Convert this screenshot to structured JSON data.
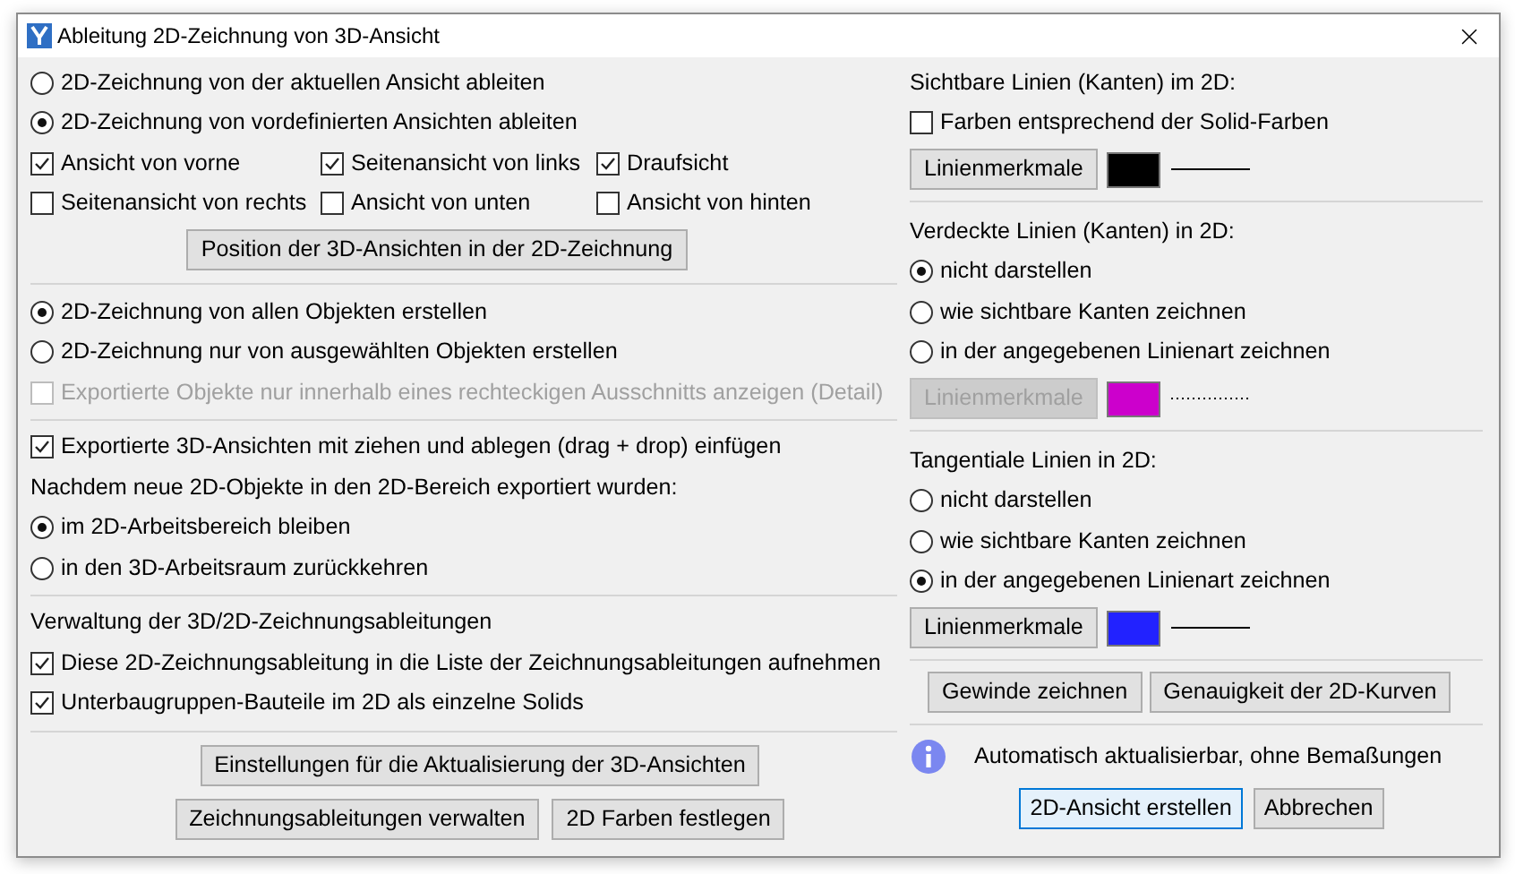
{
  "window": {
    "title": "Ableitung 2D-Zeichnung von 3D-Ansicht"
  },
  "left": {
    "source_options": [
      {
        "label": "2D-Zeichnung von der aktuellen Ansicht ableiten",
        "selected": false
      },
      {
        "label": "2D-Zeichnung von vordefinierten Ansichten ableiten",
        "selected": true
      }
    ],
    "views": [
      {
        "label": "Ansicht von vorne",
        "checked": true
      },
      {
        "label": "Seitenansicht von links",
        "checked": true
      },
      {
        "label": "Draufsicht",
        "checked": true
      },
      {
        "label": "Seitenansicht von rechts",
        "checked": false
      },
      {
        "label": "Ansicht von unten",
        "checked": false
      },
      {
        "label": "Ansicht von hinten",
        "checked": false
      }
    ],
    "position_button": "Position der 3D-Ansichten in der 2D-Zeichnung",
    "object_options": [
      {
        "label": "2D-Zeichnung von allen Objekten erstellen",
        "selected": true
      },
      {
        "label": "2D-Zeichnung nur von ausgewählten Objekten erstellen",
        "selected": false
      }
    ],
    "detail_option": {
      "label": "Exportierte Objekte nur innerhalb eines rechteckigen Ausschnitts anzeigen (Detail)",
      "checked": false,
      "disabled": true
    },
    "drag_drop": {
      "label": "Exportierte 3D-Ansichten mit ziehen und ablegen (drag + drop) einfügen",
      "checked": true
    },
    "after_export_label": "Nachdem neue 2D-Objekte in den 2D-Bereich exportiert wurden:",
    "after_export_options": [
      {
        "label": "im 2D-Arbeitsbereich bleiben",
        "selected": true
      },
      {
        "label": "in den 3D-Arbeitsraum zurückkehren",
        "selected": false
      }
    ],
    "management_label": "Verwaltung der 3D/2D-Zeichnungsableitungen",
    "management_options": [
      {
        "label": "Diese 2D-Zeichnungsableitung in die Liste der Zeichnungsableitungen aufnehmen",
        "checked": true
      },
      {
        "label": "Unterbaugruppen-Bauteile im 2D als einzelne Solids",
        "checked": true
      }
    ],
    "update_button": "Einstellungen für die Aktualisierung der 3D-Ansichten",
    "bottom_buttons": [
      "Zeichnungsableitungen verwalten",
      "2D Farben festlegen"
    ]
  },
  "right": {
    "sections": [
      {
        "title": "Sichtbare Linien (Kanten) im 2D:",
        "checkbox": {
          "label": "Farben entsprechend der Solid-Farben",
          "checked": false
        },
        "line_button": {
          "label": "Linienmerkmale",
          "disabled": false
        },
        "color": "#000000",
        "kind": "solid"
      },
      {
        "title": "Verdeckte Linien (Kanten) in 2D:",
        "options": [
          {
            "label": "nicht darstellen",
            "selected": true
          },
          {
            "label": "wie sichtbare Kanten zeichnen",
            "selected": false
          },
          {
            "label": "in der angegebenen Linienart zeichnen",
            "selected": false
          }
        ],
        "line_button": {
          "label": "Linienmerkmale",
          "disabled": true
        },
        "color": "#cc00cc",
        "kind": "dotted"
      },
      {
        "title": "Tangentiale Linien in 2D:",
        "options": [
          {
            "label": "nicht darstellen",
            "selected": false
          },
          {
            "label": "wie sichtbare Kanten zeichnen",
            "selected": false
          },
          {
            "label": "in der angegebenen Linienart zeichnen",
            "selected": true
          }
        ],
        "line_button": {
          "label": "Linienmerkmale",
          "disabled": false
        },
        "color": "#2222ff",
        "kind": "solid"
      }
    ],
    "tool_buttons": [
      "Gewinde zeichnen",
      "Genauigkeit der 2D-Kurven"
    ],
    "info_text": "Automatisch aktualisierbar, ohne Bemaßungen",
    "action_buttons": [
      {
        "label": "2D-Ansicht erstellen",
        "default": true
      },
      {
        "label": "Abbrechen",
        "default": false
      }
    ]
  }
}
